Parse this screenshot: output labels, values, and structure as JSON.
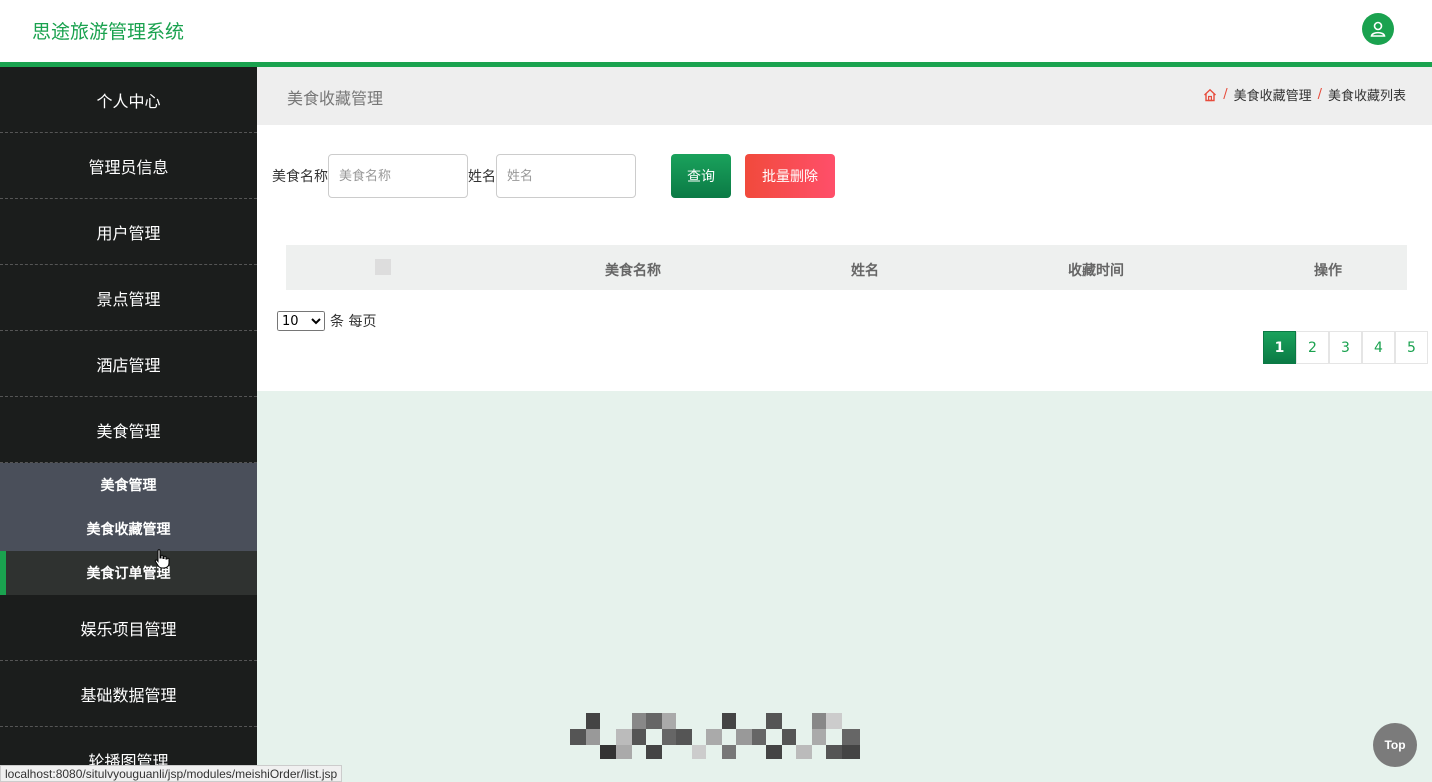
{
  "header": {
    "title": "思途旅游管理系统",
    "user_icon": "user-icon"
  },
  "sidebar": {
    "items": [
      {
        "label": "个人中心"
      },
      {
        "label": "管理员信息"
      },
      {
        "label": "用户管理"
      },
      {
        "label": "景点管理"
      },
      {
        "label": "酒店管理"
      },
      {
        "label": "美食管理",
        "expanded": true,
        "children": [
          {
            "label": "美食管理"
          },
          {
            "label": "美食收藏管理"
          },
          {
            "label": "美食订单管理",
            "hovered": true
          }
        ]
      },
      {
        "label": "娱乐项目管理"
      },
      {
        "label": "基础数据管理"
      },
      {
        "label": "轮播图管理"
      }
    ]
  },
  "content": {
    "page_title": "美食收藏管理",
    "breadcrumb": {
      "home_icon": "home-icon",
      "sep": "/",
      "level1": "美食收藏管理",
      "level2": "美食收藏列表"
    }
  },
  "search": {
    "food_label": "美食名称",
    "food_placeholder": "美食名称",
    "name_label": "姓名",
    "name_placeholder": "姓名",
    "query_button": "查询",
    "batch_delete_button": "批量删除"
  },
  "table": {
    "columns": [
      "美食名称",
      "姓名",
      "收藏时间",
      "操作"
    ]
  },
  "pagination": {
    "page_size": "10",
    "page_size_options": [
      "10"
    ],
    "page_size_suffix": "条 每页",
    "pages": [
      "1",
      "2",
      "3",
      "4",
      "5"
    ],
    "current": "1"
  },
  "floating": {
    "top_button": "Top"
  },
  "status_bar": {
    "url": "localhost:8080/situlvyouguanli/jsp/modules/meishiOrder/list.jsp"
  },
  "colors": {
    "accent": "#1aa24f",
    "danger": "#f14a3c",
    "sidebar_bg": "#1b1d1c"
  }
}
